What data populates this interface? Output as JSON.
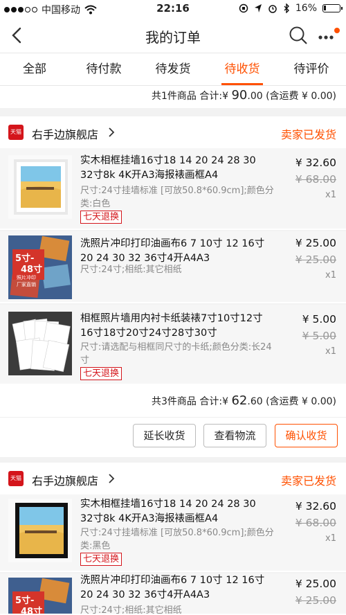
{
  "status_bar": {
    "carrier": "中国移动",
    "time": "22:16",
    "battery": "16%",
    "battery_level": 0.16
  },
  "nav": {
    "title": "我的订单"
  },
  "tabs": [
    {
      "label": "全部"
    },
    {
      "label": "待付款"
    },
    {
      "label": "待发货"
    },
    {
      "label": "待收货",
      "active": true
    },
    {
      "label": "待评价"
    }
  ],
  "prev_order": {
    "count_text": "共1件商品",
    "total_label": "合计:",
    "currency": "¥",
    "total_int": "90",
    "total_dec": ".00",
    "shipping": "(含运费 ¥ 0.00)"
  },
  "orders": [
    {
      "shop_badge": "天猫",
      "shop_name": "右手边旗舰店",
      "status": "卖家已发货",
      "items": [
        {
          "title": "实木相框挂墙16寸18 14 20 24 28 30 32寸8k 4K开A3海报裱画框A4",
          "spec": "尺寸:24寸挂墙标准 [可放50.8*60.9cm];颜色分类:白色",
          "refund_tag": "七天退换",
          "price": "¥ 32.60",
          "orig_price": "¥ 68.00",
          "qty": "x1"
        },
        {
          "title": "洗照片冲印打印油画布6 7 10寸 12 16寸 20 24 30 32 36寸4开A4A3",
          "spec": "尺寸:24寸;相纸:其它相纸",
          "thumb_text_1": "5寸-",
          "thumb_text_2": "48寸",
          "thumb_text_3": "照片冲印",
          "thumb_text_4": "厂家直销",
          "price": "¥ 25.00",
          "orig_price": "¥ 25.00",
          "qty": "x1"
        },
        {
          "title": "相框照片墙用内衬卡纸装裱7寸10寸12寸16寸18寸20寸24寸28寸30寸",
          "spec": "尺寸:请选配与相框同尺寸的卡纸;颜色分类:长24寸",
          "refund_tag": "七天退换",
          "price": "¥ 5.00",
          "orig_price": "¥ 5.00",
          "qty": "x1"
        }
      ],
      "summary": {
        "count_text": "共3件商品",
        "total_label": "合计:",
        "currency": "¥",
        "total_int": "62",
        "total_dec": ".60",
        "shipping": "(含运费 ¥ 0.00)"
      },
      "buttons": {
        "extend": "延长收货",
        "logistics": "查看物流",
        "confirm": "确认收货"
      }
    },
    {
      "shop_badge": "天猫",
      "shop_name": "右手边旗舰店",
      "status": "卖家已发货",
      "items": [
        {
          "title": "实木相框挂墙16寸18 14 20 24 28 30 32寸8k 4K开A3海报裱画框A4",
          "spec": "尺寸:24寸挂墙标准 [可放50.8*60.9cm];颜色分类:黑色",
          "refund_tag": "七天退换",
          "price": "¥ 32.60",
          "orig_price": "¥ 68.00",
          "qty": "x1"
        },
        {
          "title": "洗照片冲印打印油画布6 7 10寸 12 16寸 20 24 30 32 36寸4开A4A3",
          "spec": "尺寸:24寸;相纸:其它相纸",
          "thumb_text_1": "5寸-",
          "thumb_text_2": "48寸",
          "price": "¥ 25.00",
          "orig_price": "¥ 25.00"
        }
      ]
    }
  ],
  "colors": {
    "accent": "#ff5000",
    "tmall_red": "#d4151b"
  },
  "icons": {
    "back": "back-arrow-icon",
    "search": "search-icon",
    "more": "more-dots-icon",
    "shop_chevron": "chevron-right-icon"
  }
}
